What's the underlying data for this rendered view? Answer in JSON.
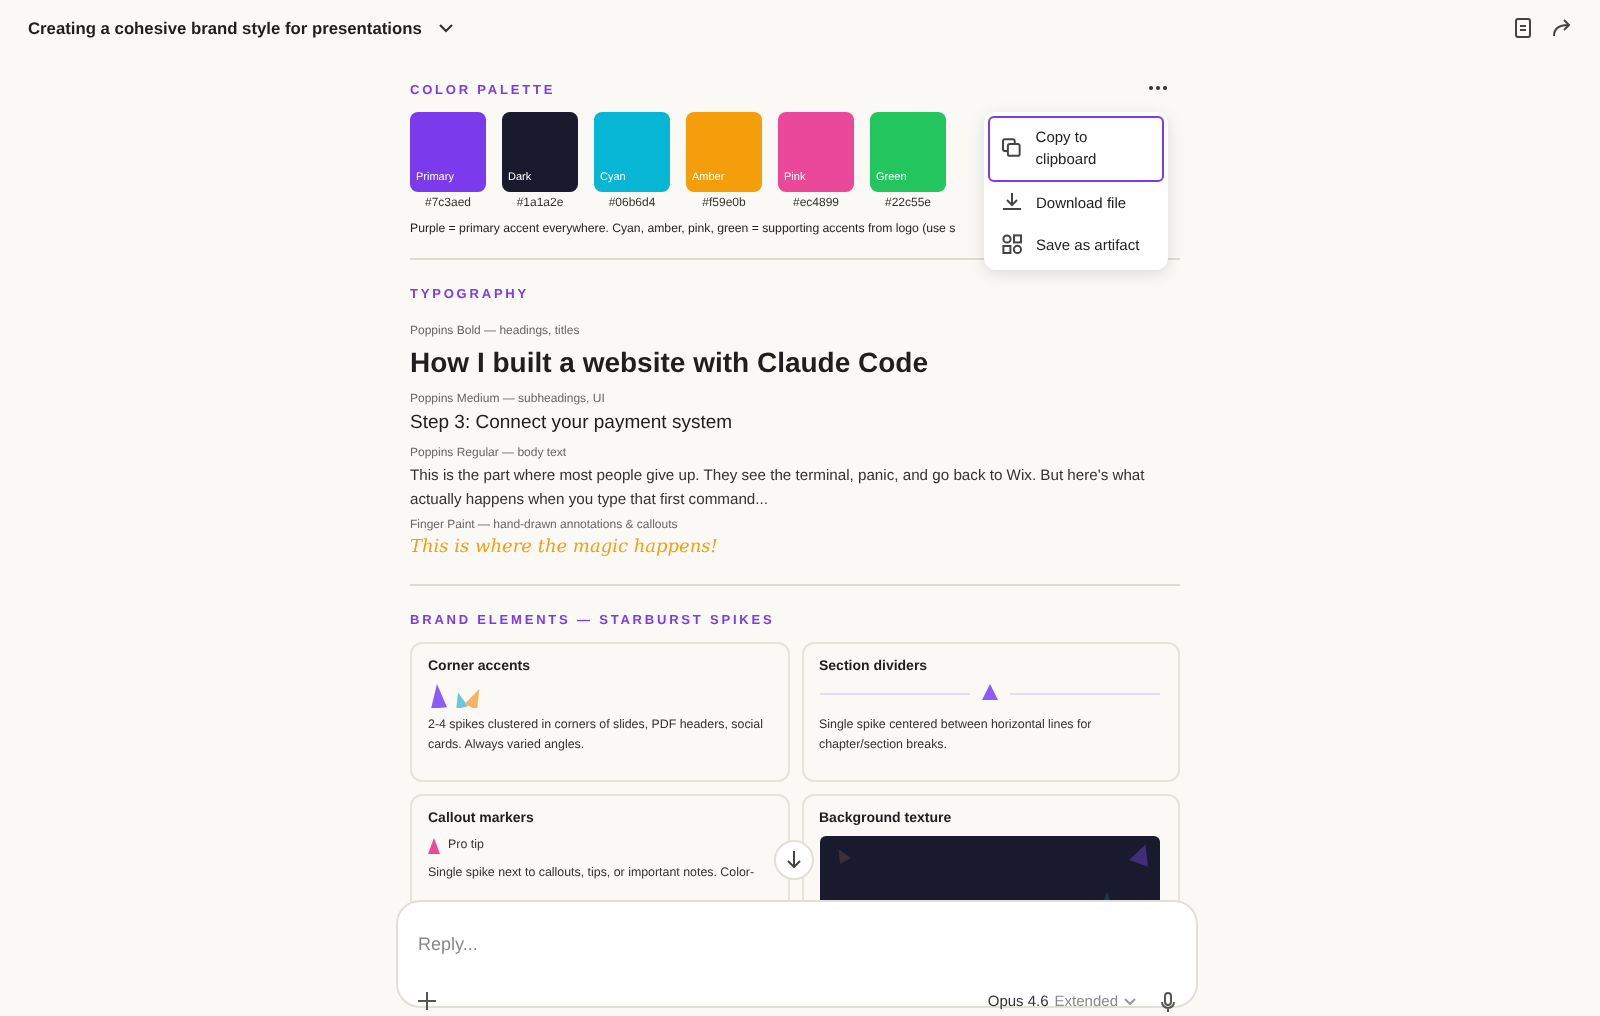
{
  "header": {
    "title": "Creating a cohesive brand style for presentations"
  },
  "sections": [
    {
      "kind": "palette",
      "heading": "COLOR PALETTE",
      "swatches": [
        {
          "name": "Primary",
          "hex": "#7c3aed",
          "color": "#7c3aed"
        },
        {
          "name": "Dark",
          "hex": "#1a1a2e",
          "color": "#1a1a2e"
        },
        {
          "name": "Cyan",
          "hex": "#06b6d4",
          "color": "#06b6d4"
        },
        {
          "name": "Amber",
          "hex": "#f59e0b",
          "color": "#f59e0b"
        },
        {
          "name": "Pink",
          "hex": "#ec4899",
          "color": "#ec4899"
        },
        {
          "name": "Green",
          "hex": "#22c55e",
          "color": "#22c55e"
        }
      ],
      "caption": "Purple = primary accent everywhere. Cyan, amber, pink, green = supporting accents from logo (use s"
    },
    {
      "kind": "typography",
      "heading": "TYPOGRAPHY",
      "samples": [
        {
          "kind": "heading",
          "label": "Poppins Bold — headings, titles",
          "text": "How I built a website with Claude Code"
        },
        {
          "kind": "subheading",
          "label": "Poppins Medium — subheadings, UI",
          "text": "Step 3: Connect your payment system"
        },
        {
          "kind": "body",
          "label": "Poppins Regular — body text",
          "text": "This is the part where most people give up. They see the terminal, panic, and go back to Wix. But here's what actually happens when you type that first command..."
        },
        {
          "kind": "annotation",
          "label": "Finger Paint — hand-drawn annotations & callouts",
          "text": "This is where the magic happens!"
        }
      ]
    },
    {
      "kind": "elements",
      "heading": "BRAND ELEMENTS — STARBURST SPIKES",
      "cards": [
        {
          "kind": "corner",
          "title": "Corner accents",
          "text": "2-4 spikes clustered in corners of slides, PDF headers, social cards. Always varied angles."
        },
        {
          "kind": "divider",
          "title": "Section dividers",
          "text": "Single spike centered between horizontal lines for chapter/section breaks."
        },
        {
          "kind": "callout",
          "title": "Callout markers",
          "tip": "Pro tip",
          "text": "Single spike next to callouts, tips, or important notes. Color-"
        },
        {
          "kind": "texture",
          "title": "Background texture"
        }
      ]
    }
  ],
  "menu": {
    "items": [
      {
        "kind": "copy",
        "label": "Copy to clipboard",
        "selected": true
      },
      {
        "kind": "download",
        "label": "Download file",
        "selected": false
      },
      {
        "kind": "artifact",
        "label": "Save as artifact",
        "selected": false
      }
    ]
  },
  "composer": {
    "placeholder": "Reply...",
    "model": "Opus 4.6",
    "mode": "Extended"
  }
}
